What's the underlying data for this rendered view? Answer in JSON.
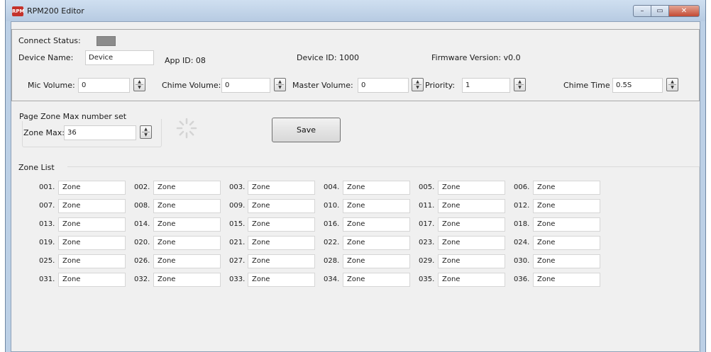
{
  "window": {
    "title": "RPM200 Editor",
    "icon_text": "RPM",
    "buttons": {
      "minimize": "–",
      "maximize": "▭",
      "close": "✕"
    }
  },
  "device": {
    "connect_status_label": "Connect Status:",
    "device_name_label": "Device Name:",
    "device_name_value": "Device",
    "app_id_label": "App ID:",
    "app_id_value": "08",
    "device_id_label": "Device ID:",
    "device_id_value": "1000",
    "firmware_label": "Firmware Version:",
    "firmware_value": "v0.0",
    "mic_volume_label": "Mic Volume:",
    "mic_volume_value": "0",
    "chime_volume_label": "Chime Volume:",
    "chime_volume_value": "0",
    "master_volume_label": "Master Volume:",
    "master_volume_value": "0",
    "priority_label": "Priority:",
    "priority_value": "1",
    "chime_time_label": "Chime Time",
    "chime_time_value": "0.5S",
    "status_color": "#8c8c8c"
  },
  "page_zone": {
    "group_title": "Page Zone Max number set",
    "zone_max_label": "Zone Max:",
    "zone_max_value": "36"
  },
  "save_label": "Save",
  "zone_list": {
    "title": "Zone List",
    "zones": [
      {
        "num": "001.",
        "name": "Zone"
      },
      {
        "num": "002.",
        "name": "Zone"
      },
      {
        "num": "003.",
        "name": "Zone"
      },
      {
        "num": "004.",
        "name": "Zone"
      },
      {
        "num": "005.",
        "name": "Zone"
      },
      {
        "num": "006.",
        "name": "Zone"
      },
      {
        "num": "007.",
        "name": "Zone"
      },
      {
        "num": "008.",
        "name": "Zone"
      },
      {
        "num": "009.",
        "name": "Zone"
      },
      {
        "num": "010.",
        "name": "Zone"
      },
      {
        "num": "011.",
        "name": "Zone"
      },
      {
        "num": "012.",
        "name": "Zone"
      },
      {
        "num": "013.",
        "name": "Zone"
      },
      {
        "num": "014.",
        "name": "Zone"
      },
      {
        "num": "015.",
        "name": "Zone"
      },
      {
        "num": "016.",
        "name": "Zone"
      },
      {
        "num": "017.",
        "name": "Zone"
      },
      {
        "num": "018.",
        "name": "Zone"
      },
      {
        "num": "019.",
        "name": "Zone"
      },
      {
        "num": "020.",
        "name": "Zone"
      },
      {
        "num": "021.",
        "name": "Zone"
      },
      {
        "num": "022.",
        "name": "Zone"
      },
      {
        "num": "023.",
        "name": "Zone"
      },
      {
        "num": "024.",
        "name": "Zone"
      },
      {
        "num": "025.",
        "name": "Zone"
      },
      {
        "num": "026.",
        "name": "Zone"
      },
      {
        "num": "027.",
        "name": "Zone"
      },
      {
        "num": "028.",
        "name": "Zone"
      },
      {
        "num": "029.",
        "name": "Zone"
      },
      {
        "num": "030.",
        "name": "Zone"
      },
      {
        "num": "031.",
        "name": "Zone"
      },
      {
        "num": "032.",
        "name": "Zone"
      },
      {
        "num": "033.",
        "name": "Zone"
      },
      {
        "num": "034.",
        "name": "Zone"
      },
      {
        "num": "035.",
        "name": "Zone"
      },
      {
        "num": "036.",
        "name": "Zone"
      }
    ]
  }
}
